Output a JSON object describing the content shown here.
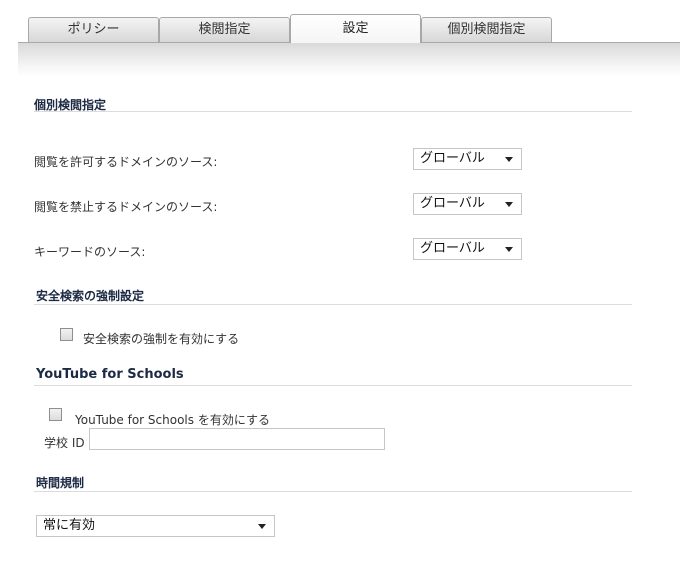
{
  "tabs": [
    {
      "label": "ポリシー"
    },
    {
      "label": "検閲指定"
    },
    {
      "label": "設定"
    },
    {
      "label": "個別検閲指定"
    }
  ],
  "active_tab": "設定",
  "sections": {
    "custom": {
      "title": "個別検閲指定",
      "allow_label": "閲覧を許可するドメインのソース:",
      "allow_value": "グローバル",
      "deny_label": "閲覧を禁止するドメインのソース:",
      "deny_value": "グローバル",
      "keyword_label": "キーワードのソース:",
      "keyword_value": "グローバル"
    },
    "safe_search": {
      "title": "安全検索の強制設定",
      "checkbox_label": "安全検索の強制を有効にする",
      "checked": false
    },
    "youtube": {
      "title": "YouTube for Schools",
      "checkbox_label": "YouTube for Schools を有効にする",
      "checked": false,
      "school_id_label": "学校 ID",
      "school_id_value": ""
    },
    "schedule": {
      "title": "時間規制",
      "value": "常に有効"
    }
  }
}
